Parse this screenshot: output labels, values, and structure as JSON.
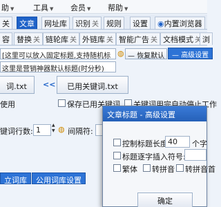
{
  "menu": {
    "items": [
      "助",
      "工具",
      "会员",
      "帮助"
    ]
  },
  "tabs_row1": {
    "tabs": [
      {
        "label": "关",
        "close": ""
      },
      {
        "label": "文章",
        "close": ""
      },
      {
        "label": "网址库",
        "close": ""
      },
      {
        "label": "识别",
        "close": "关"
      },
      {
        "label": "规则",
        "close": ""
      },
      {
        "label": "设置",
        "close": ""
      },
      {
        "label": "内置浏览器",
        "close": ""
      }
    ]
  },
  "tabs_row2": {
    "tabs": [
      {
        "label": "容",
        "close": ""
      },
      {
        "label": "替换",
        "close": "关"
      },
      {
        "label": "链轮库",
        "close": "关"
      },
      {
        "label": "外链库",
        "close": "关"
      },
      {
        "label": "智能广告",
        "close": "关"
      },
      {
        "label": "文档模式",
        "close": "关"
      },
      {
        "label": "浏",
        "close": ""
      }
    ]
  },
  "main": {
    "title_rule_hint": "[这里可以放入固定标题,支持随机标签]",
    "restore_default": "恢复默认",
    "advanced_settings": "高级设置",
    "engine_default_hint": "这里是营销神器默认标题(时分秒)",
    "title_file": "词.txt",
    "arrow_label": "<<",
    "keyword_file_button": "已用关键词.txt",
    "use_label": "使用",
    "save_used_keywords_label": "保存已用关键词",
    "stop_after_keywords_label": "关键词用完自动停止工作",
    "keyword_lines_label": "键词行数:",
    "keyword_lines_value": "1",
    "interval_label": "间隔符:",
    "private_lib_button": "立词库",
    "public_lib_button": "公用词库设置"
  },
  "dialog": {
    "title": "文章标题 - 高级设置",
    "control_length_label": "控制标题长度:",
    "length_value": "40",
    "length_unit": "个字",
    "insert_symbol_label": "标题逐字插入符号:",
    "symbol_value": "",
    "traditional_label": "繁体",
    "pinyin_label": "转拼音",
    "pinyin_first_label": "转拼音首",
    "ok_button": "确定"
  },
  "colors": {
    "accent": "#2d73d6",
    "title_bar": "#2a67c2",
    "window_bg": "#eef3fa"
  }
}
